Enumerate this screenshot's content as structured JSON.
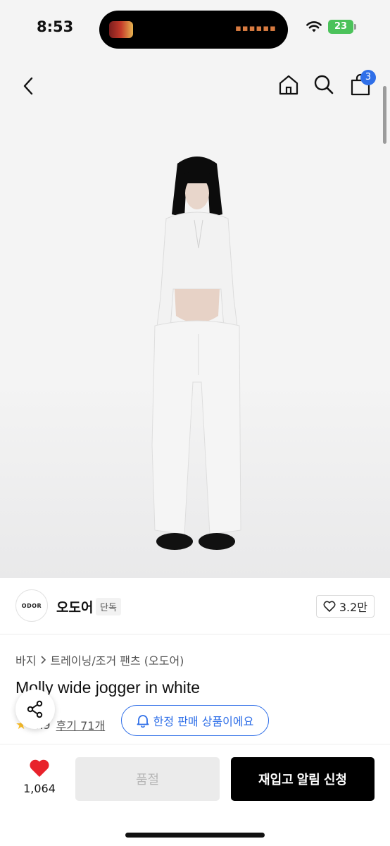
{
  "status_bar": {
    "time": "8:53",
    "battery": "23"
  },
  "header": {
    "cart_count": "3"
  },
  "colors": {
    "accent": "#2f6fe8",
    "heart": "#e8222b",
    "star": "#ffc22b"
  },
  "brand": {
    "logo_text": "ODOR",
    "name": "오도어",
    "badge": "단독",
    "likes": "3.2만"
  },
  "breadcrumb": {
    "category": "바지",
    "subcategory": "트레이닝/조거 팬츠 (오도어)"
  },
  "product": {
    "title": "Molly wide jogger in white",
    "rating": "4.9",
    "reviews": "후기 71개",
    "limited_label": "한정 판매 상품이에요"
  },
  "bottom_bar": {
    "wish_count": "1,064",
    "soldout_label": "품절",
    "restock_label": "재입고 알림 신청"
  }
}
